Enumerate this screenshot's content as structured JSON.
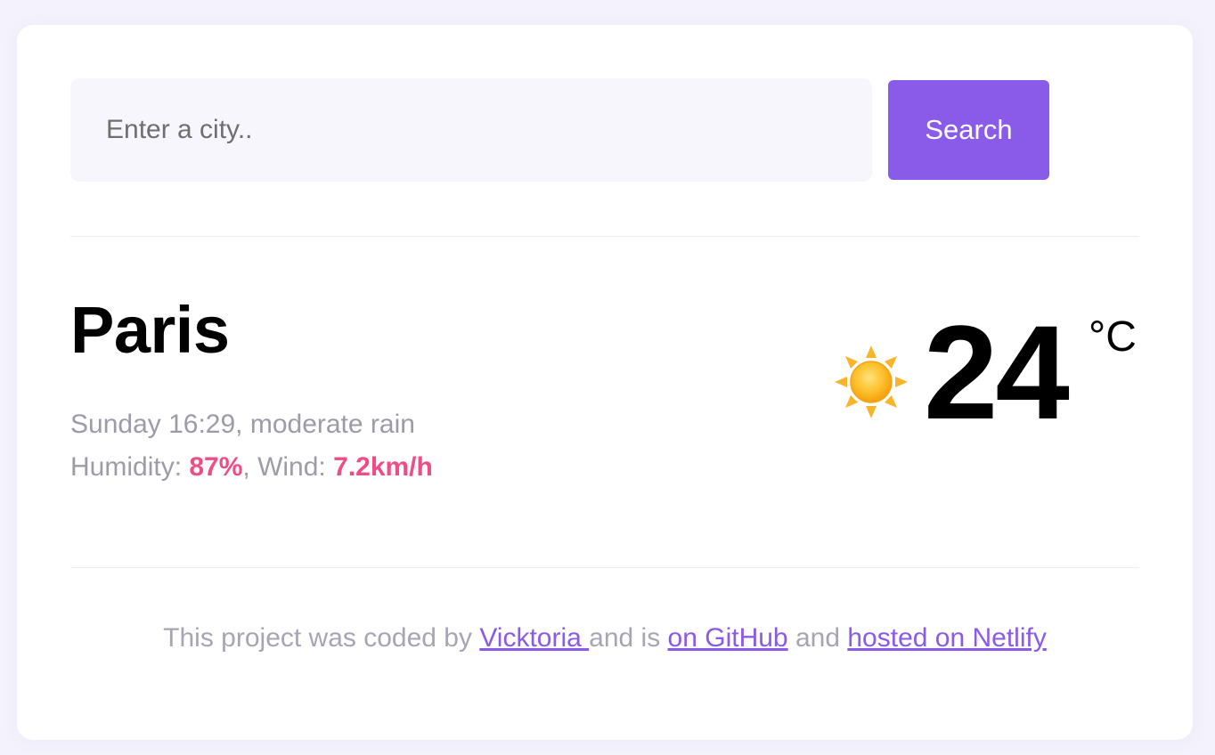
{
  "search": {
    "placeholder": "Enter a city..",
    "button_label": "Search"
  },
  "weather": {
    "city": "Paris",
    "day_time": "Sunday 16:29",
    "description": "moderate rain",
    "humidity_label": "Humidity: ",
    "humidity_value": "87%",
    "wind_label": ", Wind: ",
    "wind_value": "7.2km/h",
    "temperature": "24",
    "unit": "°C",
    "icon": "sun-icon"
  },
  "footer": {
    "prefix": "This project was coded by ",
    "author_link": "Vicktoria ",
    "middle": "and is ",
    "github_link": "on GitHub",
    "and_text": " and ",
    "netlify_link": "hosted on Netlify"
  },
  "colors": {
    "accent": "#8a5ae8",
    "highlight": "#ee4d86",
    "muted_text": "#9e9ba8",
    "background": "#f4f2fc"
  }
}
